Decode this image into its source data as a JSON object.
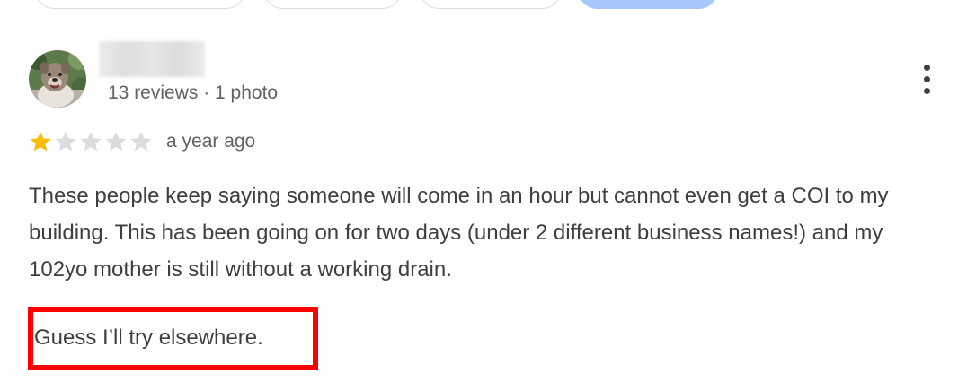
{
  "filter_chips": [
    {
      "label": ""
    },
    {
      "label": ""
    },
    {
      "label": ""
    },
    {
      "label": "",
      "selected": true
    }
  ],
  "review": {
    "reviewer": {
      "name": "",
      "name_blurred": true,
      "meta": "13 reviews · 1 photo",
      "avatar": "dog-photo"
    },
    "rating": {
      "value": 1,
      "max": 5,
      "star_filled_color": "#fbbc04",
      "star_empty_color": "#dadce0"
    },
    "date": "a year ago",
    "text": "These people keep saying someone will come in an hour but cannot even get a COI to my building. This has been going on for two days (under 2 different business names!) and my 102yo mother is still without a working drain.",
    "closing": "Guess I’ll try elsewhere.",
    "more_options_icon": "more-vert-icon"
  },
  "annotation": {
    "type": "highlight-box",
    "color": "#ff0000",
    "target": "review.closing"
  }
}
